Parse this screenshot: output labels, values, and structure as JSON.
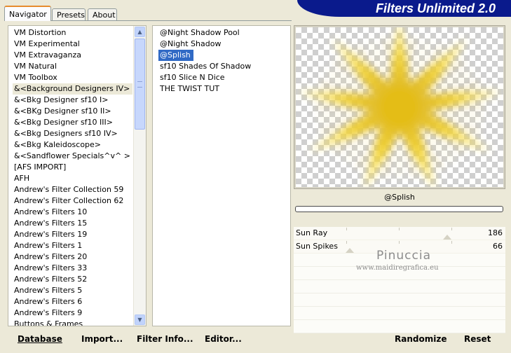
{
  "app_title": "Filters Unlimited 2.0",
  "tabs": [
    {
      "label": "Navigator",
      "active": true
    },
    {
      "label": "Presets",
      "active": false
    },
    {
      "label": "About",
      "active": false
    }
  ],
  "categories": [
    "VM Distortion",
    "VM Experimental",
    "VM Extravaganza",
    "VM Natural",
    "VM Toolbox",
    "&<Background Designers IV>",
    "&<Bkg Designer sf10 I>",
    "&<BKg Designer sf10 II>",
    "&<Bkg Designer sf10 III>",
    "&<Bkg Designers sf10 IV>",
    "&<Bkg Kaleidoscope>",
    "&<Sandflower Specials^v^ >",
    "[AFS IMPORT]",
    "AFH",
    "Andrew's Filter Collection 59",
    "Andrew's Filter Collection 62",
    "Andrew's Filters 10",
    "Andrew's Filters 15",
    "Andrew's Filters 19",
    "Andrew's Filters 1",
    "Andrew's Filters 20",
    "Andrew's Filters 33",
    "Andrew's Filters 52",
    "Andrew's Filters 5",
    "Andrew's Filters 6",
    "Andrew's Filters 9",
    "Buttons & Frames"
  ],
  "highlighted_category_index": 5,
  "filters": [
    "@Night Shadow Pool",
    "@Night Shadow",
    "@Splish",
    "sf10 Shades Of Shadow",
    "sf10 Slice N Dice",
    "THE TWIST TUT"
  ],
  "selected_filter_index": 2,
  "preview": {
    "filter_name": "@Splish",
    "progress": 0
  },
  "params": [
    {
      "label": "Sun Ray",
      "value": "186",
      "level": 0.73
    },
    {
      "label": "Sun Spikes",
      "value": "66",
      "level": 0.26
    }
  ],
  "watermark": {
    "name": "Pinuccia",
    "site": "www.maidiregrafica.eu"
  },
  "buttons": {
    "database": "Database",
    "import": "Import...",
    "filter_info": "Filter Info...",
    "editor": "Editor...",
    "randomize": "Randomize",
    "reset": "Reset"
  },
  "colors": {
    "banner": "#0a1a8c",
    "selection": "#316ac5",
    "star": "#f2d22a"
  }
}
